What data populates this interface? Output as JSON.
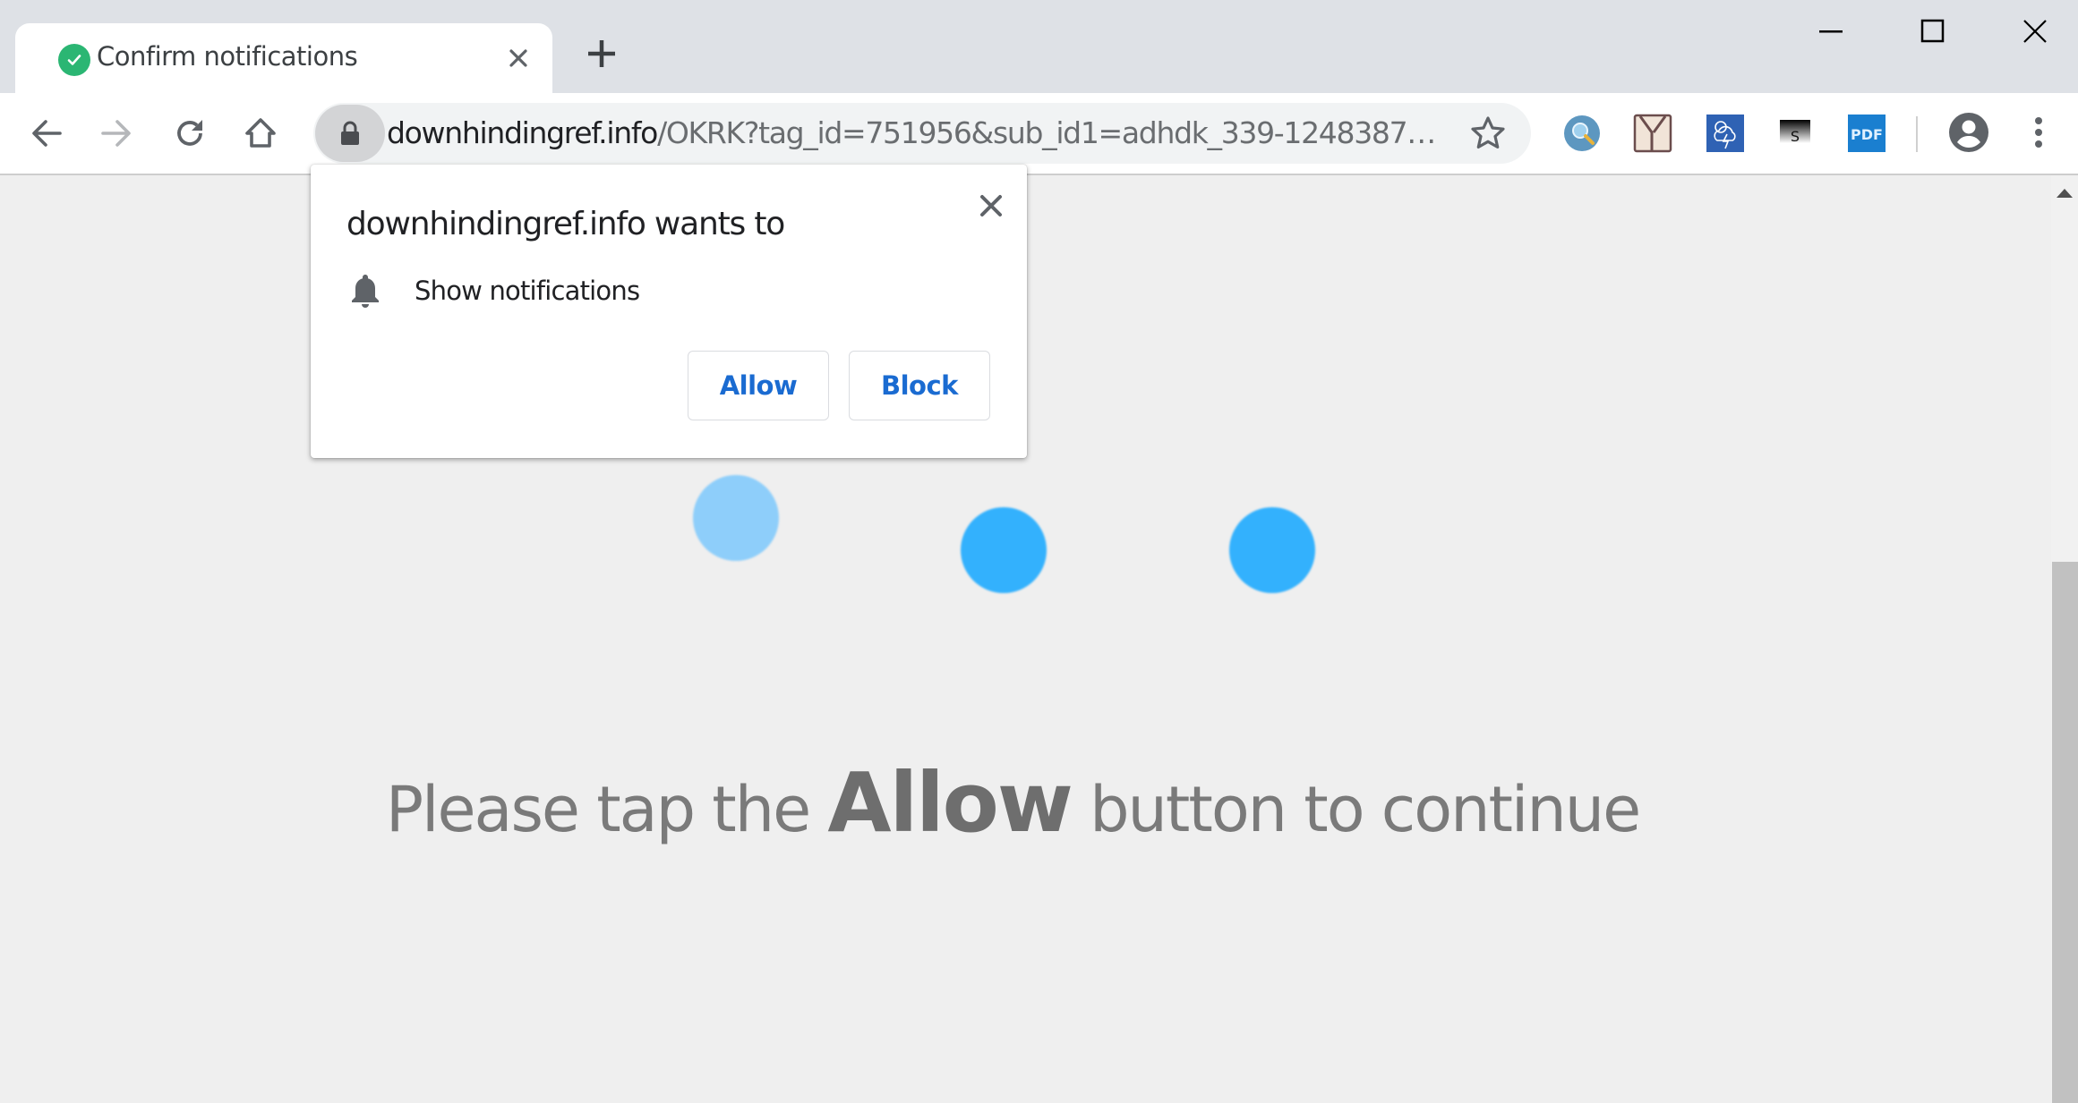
{
  "browser": {
    "tabs": [
      {
        "title": "Confirm notifications",
        "favicon": "green-check-icon",
        "active": true
      }
    ],
    "new_tab_label": "+",
    "window_controls": [
      "minimize",
      "maximize",
      "close"
    ],
    "toolbar": {
      "nav": [
        "back",
        "forward",
        "reload",
        "home"
      ],
      "forward_enabled": false,
      "url": {
        "host": "downhindingref.info",
        "path": "/OKRK?tag_id=751956&sub_id1=adhdk_339-1248387…",
        "secure": true
      },
      "extensions": [
        {
          "name": "search-extension",
          "icon": "magnifier-icon"
        },
        {
          "name": "y-extension",
          "icon": "y-letter-icon"
        },
        {
          "name": "weather-extension",
          "icon": "storm-cloud-icon"
        },
        {
          "name": "s-extension",
          "icon": "s-letter-icon",
          "label": "S"
        },
        {
          "name": "pdf-extension",
          "icon": "pdf-icon",
          "label": "PDF"
        }
      ]
    }
  },
  "permission_prompt": {
    "heading": "downhindingref.info wants to",
    "permission": "Show notifications",
    "permission_icon": "bell-icon",
    "allow_label": "Allow",
    "block_label": "Block"
  },
  "page": {
    "message_before": "Please tap the ",
    "message_emphasis": "Allow",
    "message_after": " button to continue",
    "loader_dots": [
      {
        "color": "#8ecefa"
      },
      {
        "color": "#33b1fd"
      },
      {
        "color": "#33b1fd"
      }
    ]
  },
  "colors": {
    "accent_blue": "#1a6bd1",
    "favicon_green": "#2bb673",
    "page_background": "#efefef",
    "message_gray": "#7a7a7a"
  }
}
